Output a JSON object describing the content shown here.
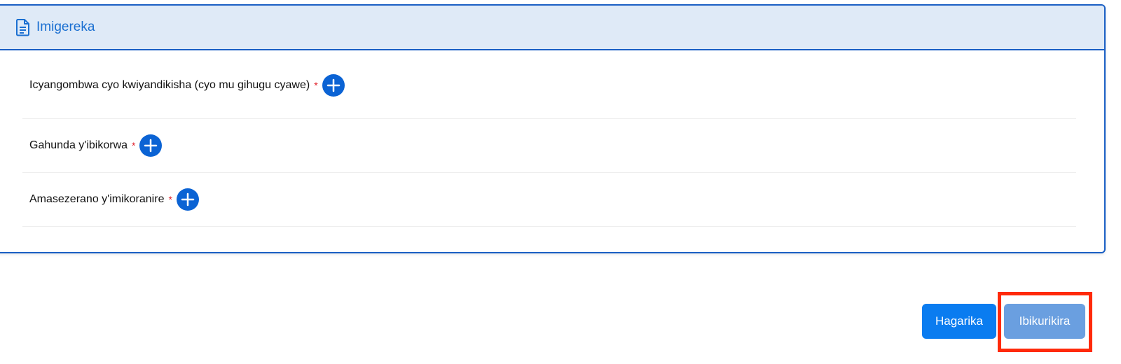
{
  "section": {
    "title": "Imigereka",
    "icon": "document-icon"
  },
  "documents": [
    {
      "label": "Icyangombwa cyo kwiyandikisha (cyo mu gihugu cyawe)",
      "required_mark": "*"
    },
    {
      "label": "Gahunda y'ibikorwa",
      "required_mark": "*"
    },
    {
      "label": "Amasezerano y'imikoranire",
      "required_mark": "*"
    }
  ],
  "actions": {
    "cancel_label": "Hagarika",
    "next_label": "Ibikurikira"
  },
  "colors": {
    "accent": "#0b63d4",
    "header_bg": "#dfeaf7",
    "required": "#e0202a",
    "highlight": "#ff2a0a"
  }
}
